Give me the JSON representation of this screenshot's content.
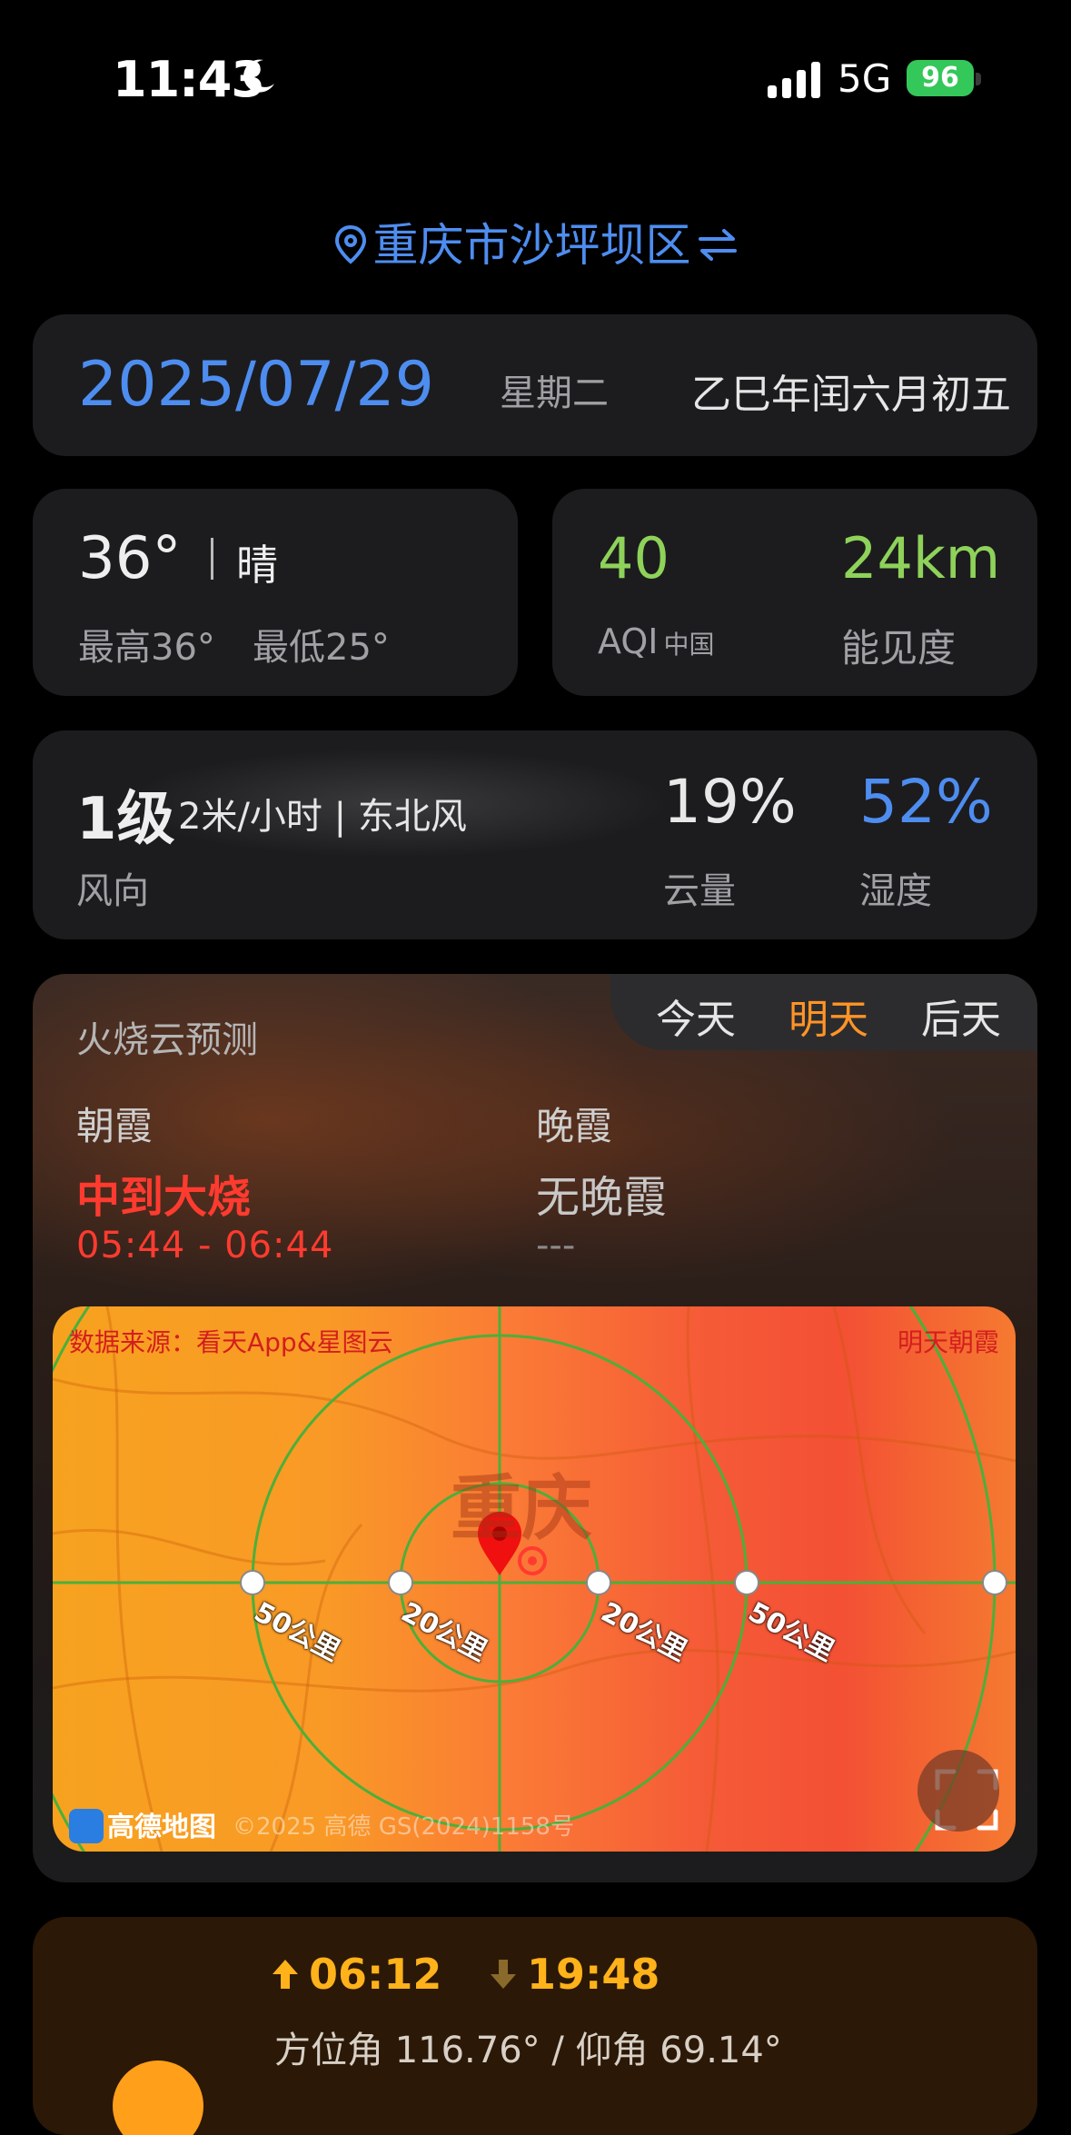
{
  "status": {
    "time": "11:43",
    "network": "5G",
    "battery": "96"
  },
  "location": {
    "name": "重庆市沙坪坝区"
  },
  "date": {
    "value": "2025/07/29",
    "weekday": "星期二",
    "lunar": "乙巳年闰六月初五"
  },
  "weather": {
    "temp": "36°",
    "condition": "晴",
    "high": "最高36°",
    "low": "最低25°"
  },
  "air": {
    "aqi": "40",
    "aqi_label": "AQI",
    "aqi_sub": "中国",
    "visibility": "24km",
    "visibility_label": "能见度"
  },
  "wind": {
    "level": "1级",
    "detail": "2米/小时 | 东北风",
    "label": "风向",
    "cloud": "19%",
    "cloud_label": "云量",
    "humidity": "52%",
    "humidity_label": "湿度"
  },
  "glow": {
    "title": "火烧云预测",
    "tabs": [
      "今天",
      "明天",
      "后天"
    ],
    "selected_tab": "明天",
    "dawn": {
      "label": "朝霞",
      "level": "中到大烧",
      "time": "05:44 - 06:44"
    },
    "dusk": {
      "label": "晚霞",
      "level": "无晚霞",
      "time": "---"
    }
  },
  "map": {
    "source": "数据来源：看天App&星图云",
    "badge": "明天朝霞",
    "city": "重庆",
    "rings": [
      "50公里",
      "20公里",
      "20公里",
      "50公里"
    ],
    "logo": "高德地图",
    "copyright": "©2025 高德 GS(2024)1158号"
  },
  "sun": {
    "sunrise": "06:12",
    "sunset": "19:48",
    "angle": "方位角 116.76° / 仰角 69.14°"
  },
  "colors": {
    "accent_blue": "#4e8df0",
    "good_green": "#8ed25a",
    "tab_orange": "#ff9426",
    "alert_red": "#ff3b30",
    "sun_gold": "#ffb21a"
  }
}
